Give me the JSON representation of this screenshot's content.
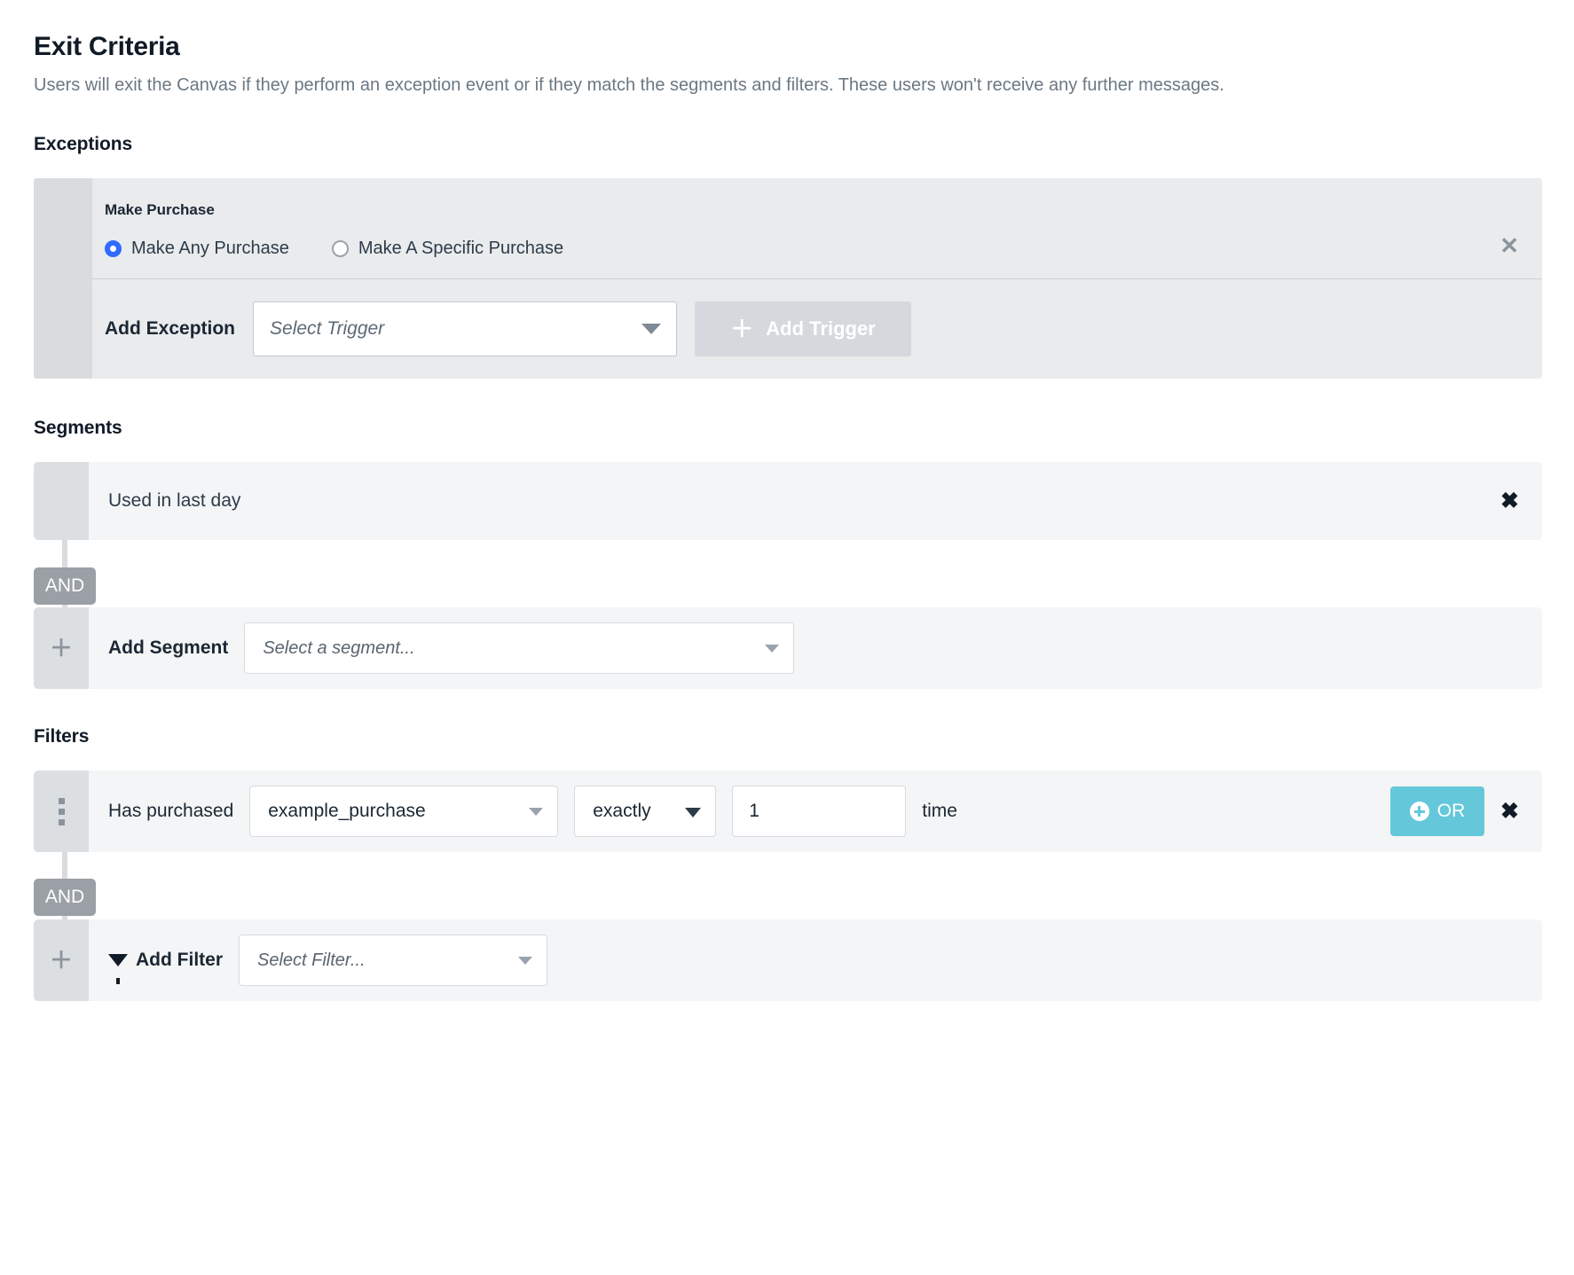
{
  "header": {
    "title": "Exit Criteria",
    "description": "Users will exit the Canvas if they perform an exception event or if they match the segments and filters. These users won't receive any further messages."
  },
  "exceptions": {
    "section_title": "Exceptions",
    "card": {
      "name": "Make Purchase",
      "radios": [
        {
          "label": "Make Any Purchase",
          "checked": true
        },
        {
          "label": "Make A Specific Purchase",
          "checked": false
        }
      ],
      "close_icon": "✕",
      "add_label": "Add Exception",
      "trigger_placeholder": "Select Trigger",
      "add_trigger_button": "Add Trigger",
      "add_trigger_plus": "＋",
      "chevron_icon": "chevron-down-icon"
    }
  },
  "segments": {
    "section_title": "Segments",
    "existing": {
      "name": "Used in last day",
      "close_icon": "✖"
    },
    "connector": "AND",
    "add": {
      "handle_icon": "＋",
      "label": "Add Segment",
      "placeholder": "Select a segment..."
    }
  },
  "filters": {
    "section_title": "Filters",
    "existing": {
      "prefix_label": "Has purchased",
      "event_value": "example_purchase",
      "operator_value": "exactly",
      "count_value": "1",
      "unit_label": "time",
      "or_button": "OR",
      "close_icon": "✖",
      "drag_handle_icon": "drag-handle-icon"
    },
    "connector": "AND",
    "add": {
      "handle_icon": "＋",
      "label": "Add Filter",
      "placeholder": "Select Filter..."
    }
  },
  "colors": {
    "accent_or": "#64c8da",
    "radio_selected": "#2f6bff",
    "row_bg": "#f4f5f6",
    "card_bg": "#e9ebed",
    "handle_bg": "#dcdfe2",
    "and_chip": "#9aa0a6"
  }
}
